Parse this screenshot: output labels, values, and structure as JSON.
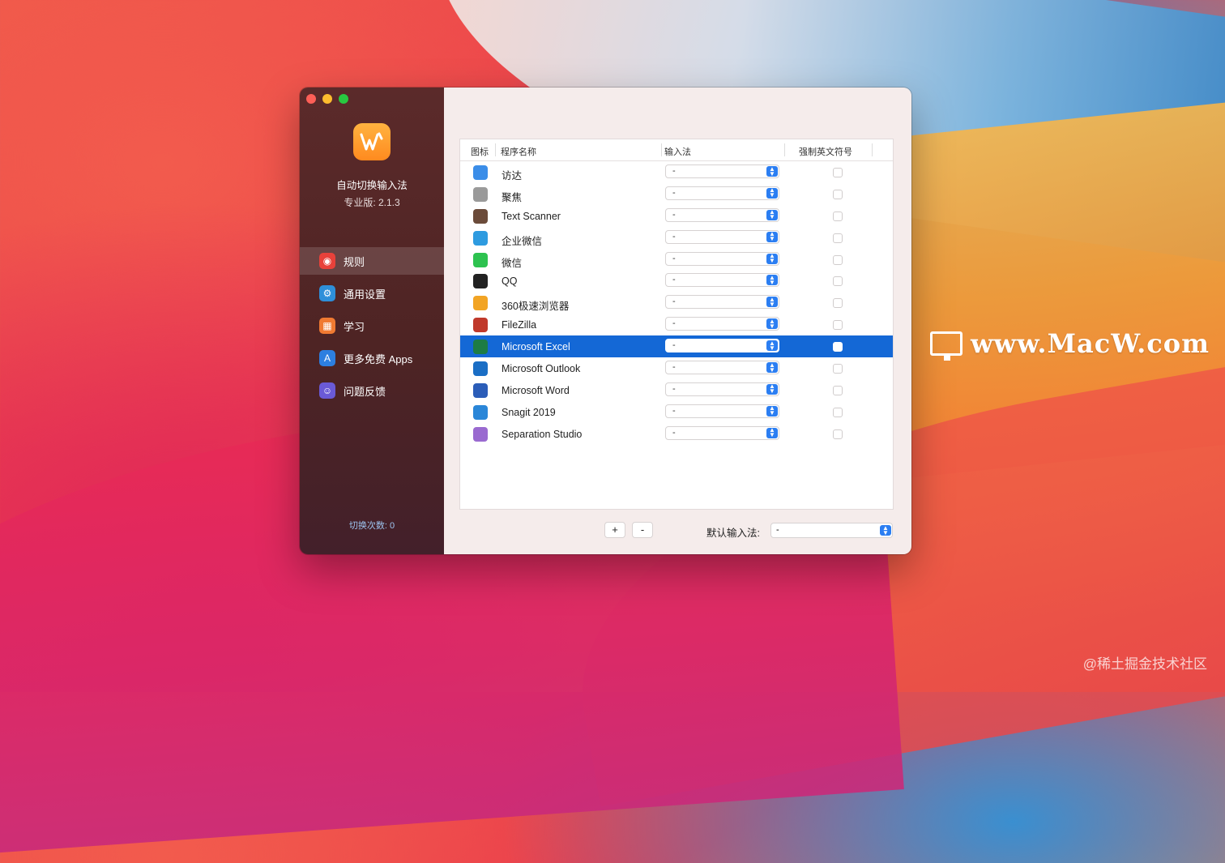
{
  "app": {
    "name": "自动切换输入法",
    "version": "专业版: 2.1.3",
    "switch_count": "切换次数: 0"
  },
  "sidebar": {
    "items": [
      {
        "label": "规则",
        "icon": "rules-icon",
        "active": true
      },
      {
        "label": "通用设置",
        "icon": "gear-icon",
        "active": false
      },
      {
        "label": "学习",
        "icon": "book-icon",
        "active": false
      },
      {
        "label": "更多免费 Apps",
        "icon": "appstore-icon",
        "active": false
      },
      {
        "label": "问题反馈",
        "icon": "feedback-icon",
        "active": false
      }
    ]
  },
  "table": {
    "headers": {
      "icon": "图标",
      "name": "程序名称",
      "input_method": "输入法",
      "force_english": "强制英文符号"
    },
    "rows": [
      {
        "name": "访达",
        "input_method": "-",
        "icon": "finder-icon",
        "color": "#3b8de8"
      },
      {
        "name": "聚焦",
        "input_method": "-",
        "icon": "spotlight-icon",
        "color": "#9a9a9a"
      },
      {
        "name": "Text Scanner",
        "input_method": "-",
        "icon": "text-scanner-icon",
        "color": "#6b4b3a"
      },
      {
        "name": "企业微信",
        "input_method": "-",
        "icon": "wecom-icon",
        "color": "#2e9be0"
      },
      {
        "name": "微信",
        "input_method": "-",
        "icon": "wechat-icon",
        "color": "#2dc24f"
      },
      {
        "name": "QQ",
        "input_method": "-",
        "icon": "qq-icon",
        "color": "#222222"
      },
      {
        "name": "360极速浏览器",
        "input_method": "-",
        "icon": "browser-360-icon",
        "color": "#f2a424"
      },
      {
        "name": "FileZilla",
        "input_method": "-",
        "icon": "filezilla-icon",
        "color": "#c0392b"
      },
      {
        "name": "Microsoft Excel",
        "input_method": "-",
        "icon": "excel-icon",
        "color": "#1d7c45",
        "selected": true
      },
      {
        "name": "Microsoft Outlook",
        "input_method": "-",
        "icon": "outlook-icon",
        "color": "#1a6ec5"
      },
      {
        "name": "Microsoft Word",
        "input_method": "-",
        "icon": "word-icon",
        "color": "#2b5db8"
      },
      {
        "name": "Snagit 2019",
        "input_method": "-",
        "icon": "snagit-icon",
        "color": "#2a86d8"
      },
      {
        "name": "Separation Studio",
        "input_method": "-",
        "icon": "separation-studio-icon",
        "color": "#9a6ad0"
      }
    ]
  },
  "footer": {
    "add_label": "+",
    "remove_label": "-",
    "default_input_label": "默认输入法:",
    "default_input_value": "-"
  },
  "watermarks": {
    "site": "www.MacW.com",
    "juejin": "@稀土掘金技术社区"
  },
  "colors": {
    "selection": "#1468d6",
    "sidebar": "#4e2424",
    "accent": "#2b7ef2"
  }
}
